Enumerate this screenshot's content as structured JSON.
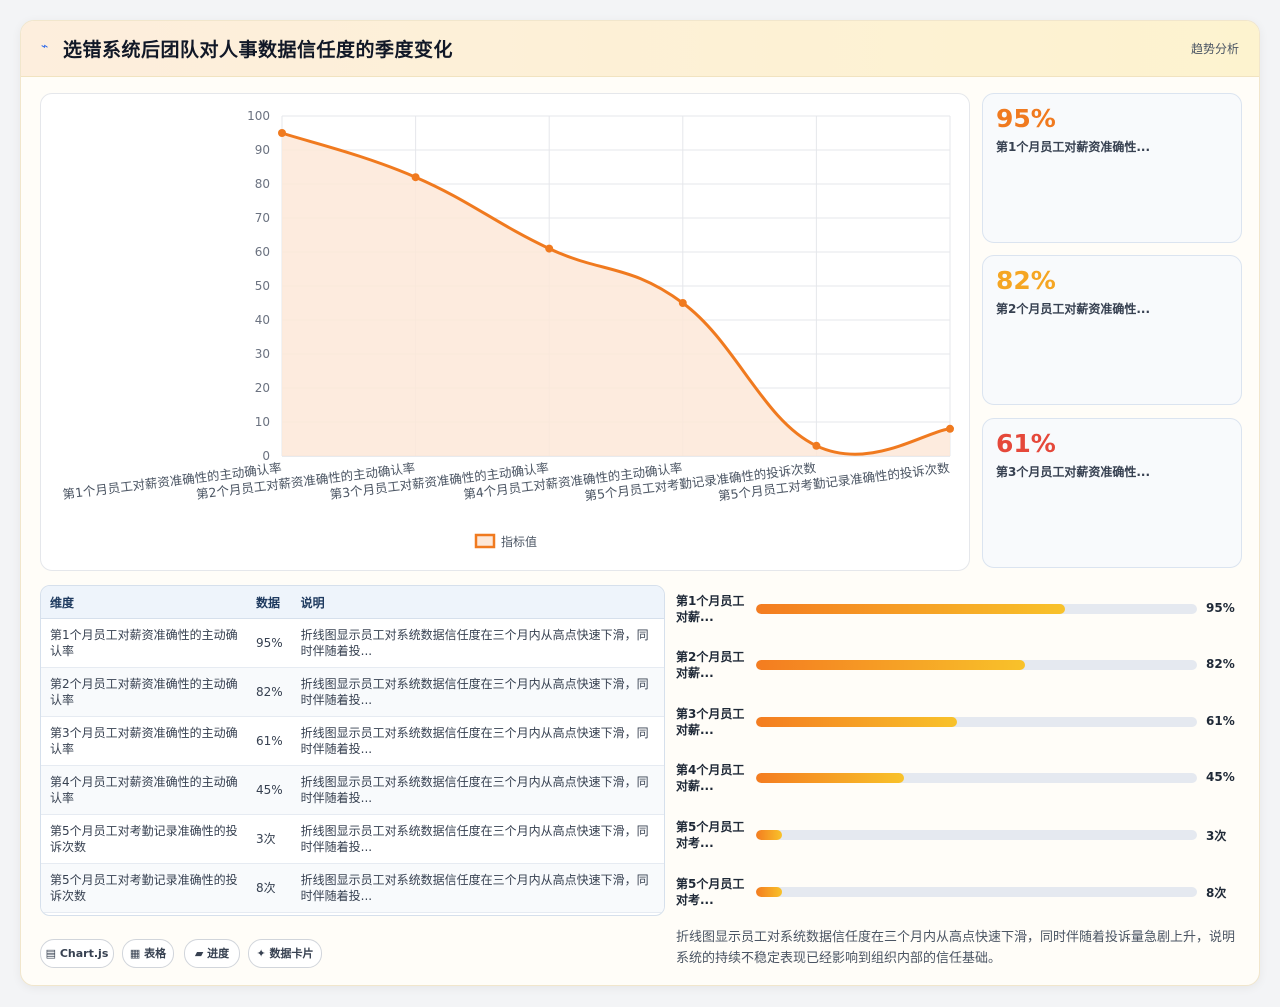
{
  "header": {
    "icon": "pulse-icon",
    "title": "选错系统后团队对人事数据信任度的季度变化",
    "right_label": "趋势分析"
  },
  "chart_data": {
    "type": "line",
    "categories": [
      "第1个月员工对薪资准确性的主动确认率",
      "第2个月员工对薪资准确性的主动确认率",
      "第3个月员工对薪资准确性的主动确认率",
      "第4个月员工对薪资准确性的主动确认率",
      "第5个月员工对考勤记录准确性的投诉次数",
      "第5个月员工对考勤记录准确性的投诉次数"
    ],
    "series": [
      {
        "name": "指标值",
        "values": [
          95,
          82,
          61,
          45,
          3,
          8
        ],
        "color": "#f07a1f",
        "fill": "#fde8d8"
      }
    ],
    "ylim": [
      0,
      100
    ],
    "yticks": [
      0,
      10,
      20,
      30,
      40,
      50,
      60,
      70,
      80,
      90,
      100
    ],
    "grid": true,
    "legend": "bottom",
    "fill_area": true,
    "smooth": true
  },
  "stats": [
    {
      "value": "95%",
      "label": "第1个月员工对薪资准确性...",
      "color": "#f07a1f"
    },
    {
      "value": "82%",
      "label": "第2个月员工对薪资准确性...",
      "color": "#f5a623"
    },
    {
      "value": "61%",
      "label": "第3个月员工对薪资准确性...",
      "color": "#e5483a"
    }
  ],
  "table": {
    "headers": [
      "维度",
      "数据",
      "说明"
    ],
    "rows": [
      [
        "第1个月员工对薪资准确性的主动确认率",
        "95%",
        "折线图显示员工对系统数据信任度在三个月内从高点快速下滑，同时伴随着投..."
      ],
      [
        "第2个月员工对薪资准确性的主动确认率",
        "82%",
        "折线图显示员工对系统数据信任度在三个月内从高点快速下滑，同时伴随着投..."
      ],
      [
        "第3个月员工对薪资准确性的主动确认率",
        "61%",
        "折线图显示员工对系统数据信任度在三个月内从高点快速下滑，同时伴随着投..."
      ],
      [
        "第4个月员工对薪资准确性的主动确认率",
        "45%",
        "折线图显示员工对系统数据信任度在三个月内从高点快速下滑，同时伴随着投..."
      ],
      [
        "第5个月员工对考勤记录准确性的投诉次数",
        "3次",
        "折线图显示员工对系统数据信任度在三个月内从高点快速下滑，同时伴随着投..."
      ],
      [
        "第5个月员工对考勤记录准确性的投诉次数",
        "8次",
        "折线图显示员工对系统数据信任度在三个月内从高点快速下滑，同时伴随着投..."
      ]
    ]
  },
  "bars": [
    {
      "name": "第1个月员工对薪...",
      "value_label": "95%",
      "fill_fraction": 0.7
    },
    {
      "name": "第2个月员工对薪...",
      "value_label": "82%",
      "fill_fraction": 0.61
    },
    {
      "name": "第3个月员工对薪...",
      "value_label": "61%",
      "fill_fraction": 0.455
    },
    {
      "name": "第4个月员工对薪...",
      "value_label": "45%",
      "fill_fraction": 0.335
    },
    {
      "name": "第5个月员工对考...",
      "value_label": "3次",
      "fill_fraction": 0.06
    },
    {
      "name": "第5个月员工对考...",
      "value_label": "8次",
      "fill_fraction": 0.06
    }
  ],
  "note": "折线图显示员工对系统数据信任度在三个月内从高点快速下滑，同时伴随着投诉量急剧上升，说明系统的持续不稳定表现已经影响到组织内部的信任基础。",
  "chips": [
    {
      "icon": "chart-icon",
      "label": "Chart.js"
    },
    {
      "icon": "table-icon",
      "label": "表格"
    },
    {
      "icon": "progress-icon",
      "label": "进度"
    },
    {
      "icon": "sparkle-icon",
      "label": "数据卡片"
    }
  ]
}
